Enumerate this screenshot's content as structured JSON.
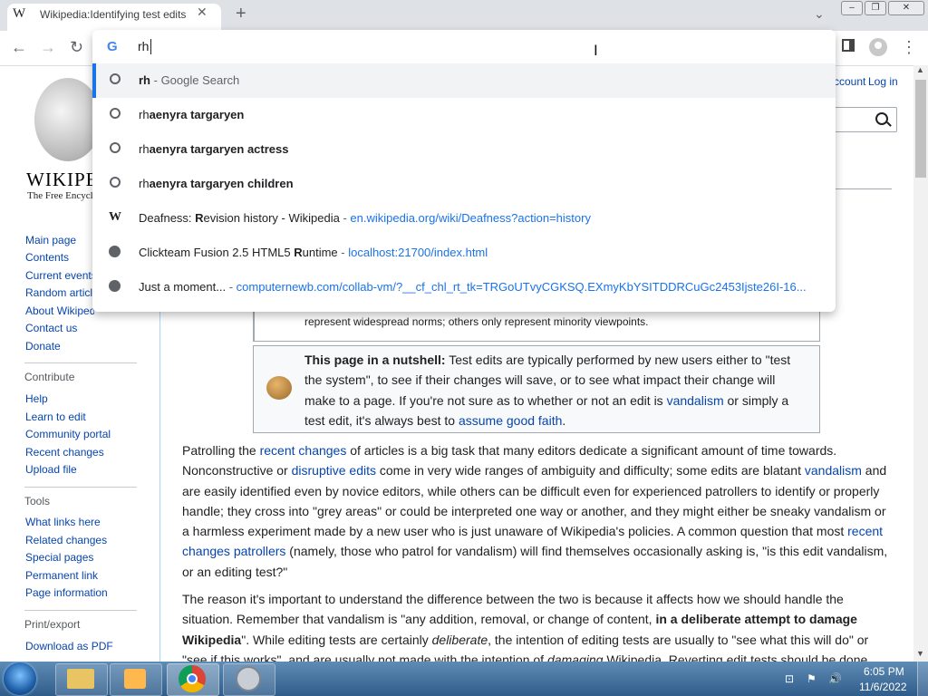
{
  "browser": {
    "tab_title": "Wikipedia:Identifying test edits",
    "tab_favicon": "W",
    "tab_close_glyph": "✕",
    "new_tab_glyph": "+",
    "tab_search_glyph": "⌄",
    "win_minimize": "–",
    "win_restore": "❐",
    "win_close": "✕",
    "back_glyph": "←",
    "forward_glyph": "→",
    "reload_glyph": "↻",
    "menu_glyph": "⋮",
    "icons": [
      "wikipedia-favicon",
      "close-icon",
      "plus-icon",
      "chevron-down-icon",
      "arrow-left-icon",
      "arrow-right-icon",
      "reload-icon",
      "side-panel-icon",
      "profile-icon",
      "kebab-menu-icon"
    ]
  },
  "omnibox": {
    "google_g": "G",
    "input_value": "rh",
    "suggestions": [
      {
        "type": "search",
        "typed": "rh",
        "rest": "",
        "sep": " - ",
        "detail": "Google Search",
        "url": ""
      },
      {
        "type": "search",
        "typed": "rh",
        "rest": "aenyra targaryen",
        "sep": "",
        "detail": "",
        "url": ""
      },
      {
        "type": "search",
        "typed": "rh",
        "rest": "aenyra targaryen actress",
        "sep": "",
        "detail": "",
        "url": ""
      },
      {
        "type": "search",
        "typed": "rh",
        "rest": "aenyra targaryen children",
        "sep": "",
        "detail": "",
        "url": ""
      },
      {
        "type": "history",
        "pre": "Deafness: ",
        "bold": "R",
        "post": "evision history - Wikipedia",
        "sep": " - ",
        "url": "en.wikipedia.org/wiki/Deafness?action=history"
      },
      {
        "type": "history",
        "pre": "Clickteam Fusion 2.5 HTML5 ",
        "bold": "R",
        "post": "untime",
        "sep": " - ",
        "url": "localhost:21700/index.html"
      },
      {
        "type": "history",
        "pre": "Just a moment...",
        "bold": "",
        "post": "",
        "sep": " - ",
        "url": "computernewb.com/collab-vm/?__cf_chl_rt_tk=TRGoUTvyCGKSQ.EXmyKbYSITDDRCuGc2453Ijste26I-16..."
      }
    ]
  },
  "wiki": {
    "wordmark": "WIKIPEDIA",
    "tagline": "The Free Encyclopedia",
    "login": "Log in",
    "account": "ccount",
    "sidebar": {
      "nav": [
        "Main page",
        "Contents",
        "Current events",
        "Random article",
        "About Wikipedia",
        "Contact us",
        "Donate"
      ],
      "contribute_heading": "Contribute",
      "contribute": [
        "Help",
        "Learn to edit",
        "Community portal",
        "Recent changes",
        "Upload file"
      ],
      "tools_heading": "Tools",
      "tools": [
        "What links here",
        "Related changes",
        "Special pages",
        "Permanent link",
        "Page information"
      ],
      "print_heading": "Print/export",
      "print": [
        "Download as PDF"
      ]
    },
    "box1_text": "represent widespread norms; others only represent minority viewpoints.",
    "nutshell": {
      "label": "This page in a nutshell:",
      "t1": " Test edits are typically performed by new users either to \"test the system\", to see if their changes will save, or to see what impact their change will make to a page. If you're not sure as to whether or not an edit is ",
      "l1": "vandalism",
      "t2": " or simply a test edit, it's always best to ",
      "l2": "assume good faith",
      "t3": "."
    },
    "para1": {
      "t1": "Patrolling the ",
      "l1": "recent changes",
      "t2": " of articles is a big task that many editors dedicate a significant amount of time towards. Nonconstructive or ",
      "l2": "disruptive edits",
      "t3": " come in very wide ranges of ambiguity and difficulty; some edits are blatant ",
      "l3": "vandalism",
      "t4": " and are easily identified even by novice editors, while others can be difficult even for experienced patrollers to identify or properly handle; they cross into \"grey areas\" or could be interpreted one way or another, and they might either be sneaky vandalism or a harmless experiment made by a new user who is just unaware of Wikipedia's policies. A common question that most ",
      "l4": "recent changes patrollers",
      "t5": " (namely, those who patrol for vandalism) will find themselves occasionally asking is, \"is this edit vandalism, or an editing test?\""
    },
    "para2": {
      "t1": "The reason it's important to understand the difference between the two is because it affects how we should handle the situation. Remember that vandalism is \"any addition, removal, or change of content, ",
      "b1": "in a deliberate attempt to damage Wikipedia",
      "t2": "\". While editing tests are certainly ",
      "i1": "deliberate",
      "t3": ", the intention of editing tests are usually to \"see what this will do\" or \"see if this works\", and are usually not made with the intention of ",
      "i2": "damaging",
      "t4": " Wikipedia. Reverting edit tests should be done"
    }
  },
  "taskbar": {
    "time": "6:05 PM",
    "date": "11/6/2022",
    "tray": [
      "⊡",
      "⚑",
      "🔊"
    ]
  }
}
